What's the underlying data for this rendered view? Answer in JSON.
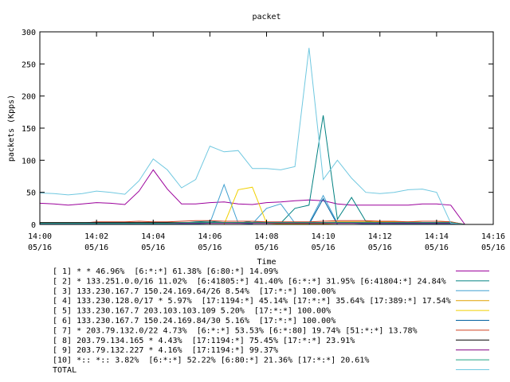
{
  "chart_data": {
    "type": "line",
    "title": "packet",
    "xlabel": "Time",
    "ylabel": "packets (Kpps)",
    "ylim": [
      0,
      300
    ],
    "yticks": [
      0,
      50,
      100,
      150,
      200,
      250,
      300
    ],
    "xlim": [
      "05/16 14:00",
      "05/16 14:16"
    ],
    "xticks": [
      {
        "time": "14:00",
        "date": "05/16"
      },
      {
        "time": "14:02",
        "date": "05/16"
      },
      {
        "time": "14:04",
        "date": "05/16"
      },
      {
        "time": "14:06",
        "date": "05/16"
      },
      {
        "time": "14:08",
        "date": "05/16"
      },
      {
        "time": "14:10",
        "date": "05/16"
      },
      {
        "time": "14:12",
        "date": "05/16"
      },
      {
        "time": "14:14",
        "date": "05/16"
      },
      {
        "time": "14:16",
        "date": "05/16"
      }
    ],
    "grid": false,
    "legend": "bottom",
    "x": [
      "14:00",
      "14:00:30",
      "14:01",
      "14:01:30",
      "14:02",
      "14:02:30",
      "14:03",
      "14:03:30",
      "14:04",
      "14:04:30",
      "14:05",
      "14:05:30",
      "14:06",
      "14:06:30",
      "14:07",
      "14:07:30",
      "14:08",
      "14:08:30",
      "14:09",
      "14:09:30",
      "14:10",
      "14:10:30",
      "14:11",
      "14:11:30",
      "14:12",
      "14:12:30",
      "14:13",
      "14:13:30",
      "14:14",
      "14:14:30",
      "14:15"
    ],
    "series": [
      {
        "name": "[ 1] * * 46.96%  [6:*:*] 61.38% [6:80:*] 14.09%",
        "color": "#9b009b",
        "values": [
          33,
          32,
          30,
          32,
          34,
          33,
          31,
          52,
          85,
          55,
          32,
          32,
          34,
          35,
          32,
          31,
          34,
          35,
          37,
          38,
          37,
          32,
          30,
          30,
          30,
          30,
          30,
          32,
          32,
          30,
          0
        ]
      },
      {
        "name": "[ 2] * 133.251.0.0/16 11.02%  [6:41805:*] 41.40% [6:*:*] 31.95% [6:41804:*] 24.84%",
        "color": "#008080",
        "values": [
          1,
          1,
          1,
          1,
          1,
          2,
          1,
          2,
          2,
          3,
          2,
          4,
          5,
          3,
          2,
          5,
          3,
          2,
          25,
          30,
          170,
          8,
          42,
          5,
          3,
          2,
          2,
          2,
          2,
          2,
          0
        ]
      },
      {
        "name": "[ 3] 133.230.167.7 150.24.169.64/26 8.54%  [17:*:*] 100.00%",
        "color": "#40a0d0",
        "values": [
          1,
          1,
          1,
          1,
          1,
          1,
          1,
          1,
          1,
          1,
          1,
          1,
          2,
          62,
          2,
          1,
          25,
          32,
          2,
          2,
          45,
          2,
          2,
          1,
          1,
          1,
          1,
          1,
          1,
          1,
          0
        ]
      },
      {
        "name": "[ 4] 133.230.128.0/17 * 5.97%  [17:1194:*] 45.14% [17:*:*] 35.64% [17:389:*] 17.54%",
        "color": "#e0a000",
        "values": [
          3,
          3,
          3,
          3,
          3,
          3,
          3,
          3,
          3,
          3,
          3,
          3,
          3,
          3,
          3,
          3,
          3,
          3,
          3,
          3,
          3,
          4,
          4,
          4,
          4,
          4,
          4,
          5,
          5,
          4,
          0
        ]
      },
      {
        "name": "[ 5] 133.230.167.7 203.103.103.109 5.20%  [17:*:*] 100.00%",
        "color": "#f0d000",
        "values": [
          0,
          0,
          0,
          0,
          0,
          0,
          0,
          0,
          0,
          0,
          0,
          0,
          0,
          0,
          54,
          58,
          2,
          1,
          1,
          1,
          1,
          0,
          0,
          0,
          0,
          0,
          0,
          0,
          0,
          0,
          0
        ]
      },
      {
        "name": "[ 6] 133.230.167.7 150.24.169.84/30 5.16%  [17:*:*] 100.00%",
        "color": "#0060a0",
        "values": [
          0,
          0,
          0,
          0,
          0,
          0,
          0,
          0,
          0,
          0,
          0,
          0,
          0,
          0,
          0,
          0,
          0,
          0,
          0,
          0,
          40,
          0,
          0,
          0,
          0,
          0,
          0,
          0,
          0,
          0,
          0
        ]
      },
      {
        "name": "[ 7] * 203.79.132.0/22 4.73%  [6:*:*] 53.53% [6:*:80] 19.74% [51:*:*] 13.78%",
        "color": "#d04020",
        "values": [
          2,
          2,
          2,
          2,
          4,
          4,
          4,
          5,
          4,
          4,
          5,
          6,
          6,
          5,
          5,
          5,
          4,
          4,
          4,
          4,
          5,
          6,
          6,
          6,
          5,
          5,
          4,
          5,
          5,
          4,
          0
        ]
      },
      {
        "name": "[ 8] 203.79.134.165 * 4.43%  [17:1194:*] 75.45% [17:*:*] 23.91%",
        "color": "#000000",
        "values": [
          3,
          3,
          3,
          3,
          3,
          3,
          3,
          3,
          3,
          3,
          3,
          3,
          3,
          3,
          3,
          3,
          3,
          3,
          3,
          3,
          3,
          3,
          3,
          3,
          3,
          3,
          3,
          3,
          3,
          3,
          0
        ]
      },
      {
        "name": "[ 9] 203.79.132.227 * 4.16%  [17:1194:*] 99.37%",
        "color": "#800080",
        "values": [
          2,
          2,
          2,
          2,
          2,
          2,
          2,
          2,
          2,
          2,
          2,
          2,
          2,
          2,
          2,
          2,
          2,
          2,
          2,
          2,
          2,
          2,
          2,
          2,
          2,
          2,
          2,
          2,
          2,
          2,
          0
        ]
      },
      {
        "name": "[10] *:: *:: 3.82%  [6:*:*] 52.22% [6:80:*] 21.36% [17:*:*] 20.61%",
        "color": "#20a080",
        "values": [
          2,
          2,
          2,
          2,
          2,
          2,
          2,
          2,
          2,
          2,
          3,
          3,
          3,
          3,
          3,
          3,
          3,
          3,
          3,
          3,
          3,
          3,
          3,
          3,
          3,
          3,
          3,
          3,
          3,
          3,
          0
        ]
      },
      {
        "name": "TOTAL",
        "color": "#70c8e0",
        "values": [
          49,
          48,
          46,
          48,
          52,
          50,
          47,
          68,
          102,
          85,
          57,
          70,
          122,
          113,
          115,
          87,
          87,
          85,
          90,
          275,
          70,
          100,
          72,
          50,
          48,
          50,
          54,
          55,
          50,
          2,
          0
        ]
      }
    ]
  }
}
